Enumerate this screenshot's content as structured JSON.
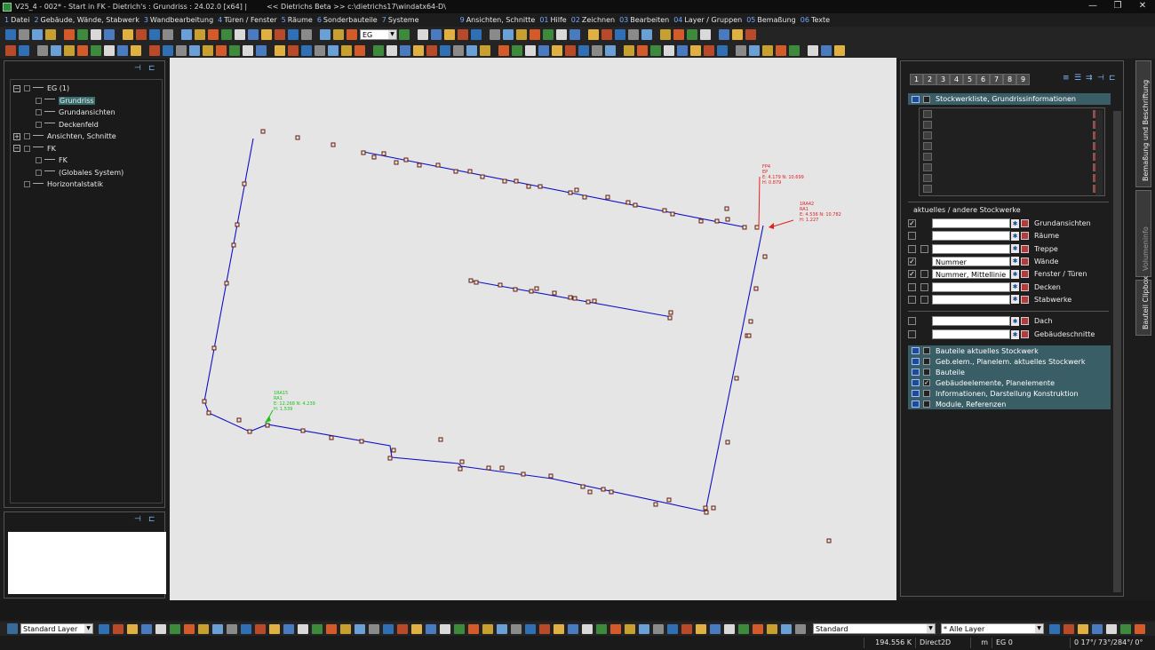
{
  "window": {
    "title_left": "V25_4 - 002* - Start in FK - Dietrich's : Grundriss : 24.02.0 [x64] |",
    "title_right": "<< Dietrichs Beta >> c:\\dietrichs17\\windatx64-D\\",
    "controls": [
      "—",
      "❐",
      "✕"
    ]
  },
  "menu": [
    {
      "num": "1",
      "label": "Datei"
    },
    {
      "num": "2",
      "label": "Gebäude, Wände, Stabwerk"
    },
    {
      "num": "3",
      "label": "Wandbearbeitung"
    },
    {
      "num": "4",
      "label": "Türen / Fenster"
    },
    {
      "num": "5",
      "label": "Räume"
    },
    {
      "num": "6",
      "label": "Sonderbauteile"
    },
    {
      "num": "7",
      "label": "Systeme"
    },
    {
      "num": "9",
      "label": "Ansichten, Schnitte"
    },
    {
      "num": "01",
      "label": "Hilfe"
    },
    {
      "num": "02",
      "label": "Zeichnen"
    },
    {
      "num": "03",
      "label": "Bearbeiten"
    },
    {
      "num": "04",
      "label": "Layer / Gruppen"
    },
    {
      "num": "05",
      "label": "Bemaßung"
    },
    {
      "num": "06",
      "label": "Texte"
    }
  ],
  "toolbar": {
    "floor_select": "EG"
  },
  "tree": [
    {
      "level": 0,
      "expander": "−",
      "label": "EG (1)",
      "selected": false
    },
    {
      "level": 1,
      "expander": "",
      "label": "Grundriss",
      "selected": true
    },
    {
      "level": 1,
      "expander": "",
      "label": "Grundansichten",
      "selected": false
    },
    {
      "level": 1,
      "expander": "",
      "label": "Deckenfeld",
      "selected": false
    },
    {
      "level": 0,
      "expander": "+",
      "label": "Ansichten, Schnitte",
      "selected": false
    },
    {
      "level": 0,
      "expander": "−",
      "label": "FK",
      "selected": false
    },
    {
      "level": 1,
      "expander": "",
      "label": "FK",
      "selected": false
    },
    {
      "level": 1,
      "expander": "",
      "label": "(Globales System)",
      "selected": false
    },
    {
      "level": 0,
      "expander": "",
      "label": "Horizontalstatik",
      "selected": false
    }
  ],
  "right_panel": {
    "tabs": [
      "1",
      "2",
      "3",
      "4",
      "5",
      "6",
      "7",
      "8",
      "9"
    ],
    "header": "Stockwerkliste, Grundrissinformationen",
    "group_label": "aktuelles / andere Stockwerke",
    "layers": [
      {
        "label": "Grundansichten",
        "checked": true,
        "value": "",
        "dual": false
      },
      {
        "label": "Räume",
        "checked": false,
        "value": "",
        "dual": false
      },
      {
        "label": "Treppe",
        "checked": false,
        "value": "",
        "dual": true
      },
      {
        "label": "Wände",
        "checked": true,
        "value": "Nummer",
        "dual": false
      },
      {
        "label": "Fenster / Türen",
        "checked": true,
        "value": "Nummer, Mittellinie",
        "dual": true
      },
      {
        "label": "Decken",
        "checked": false,
        "value": "",
        "dual": true
      },
      {
        "label": "Stabwerke",
        "checked": false,
        "value": "",
        "dual": true
      }
    ],
    "layers2": [
      {
        "label": "Dach",
        "checked": false,
        "value": ""
      },
      {
        "label": "Gebäudeschnitte",
        "checked": false,
        "value": ""
      }
    ],
    "info_rows": [
      {
        "label": "Bauteile aktuelles Stockwerk",
        "checked": false
      },
      {
        "label": "Geb.elem., Planelem. aktuelles Stockwerk",
        "checked": false
      },
      {
        "label": "Bauteile",
        "checked": false
      },
      {
        "label": "Gebäudeelemente, Planelemente",
        "checked": true
      },
      {
        "label": "Informationen, Darstellung Konstruktion",
        "checked": false
      },
      {
        "label": "Module, Referenzen",
        "checked": false
      }
    ]
  },
  "side_tabs": [
    "Bemaßung und Beschriftung",
    "Volumeninfo",
    "Bauteil Clipbox"
  ],
  "annotations": {
    "fp4": [
      "FP4",
      "EP",
      "E: 4.179 N: 10.699",
      "H: 0.879"
    ],
    "ra42": [
      "1RA42",
      "RA1",
      "E: 4.536 N: 10.782",
      "H: 1.227"
    ],
    "ra15": [
      "1RA15",
      "RA1",
      "E: 12.268 N: 4.239",
      "H: 1.539"
    ]
  },
  "colors": {
    "wall_line": "#1010c8",
    "annotation_red": "#e02020",
    "annotation_green": "#20c020",
    "canvas": "#e5e5e5",
    "panel_accent": "#3a5e66"
  },
  "bottom_toolbar": {
    "layer_select": "Standard Layer",
    "style_select": "Standard",
    "layers_filter": "* Alle Layer"
  },
  "status": {
    "memory": "194.556 K",
    "renderer": "Direct2D",
    "unit": "m",
    "floor": "EG 0",
    "angles": "0 17°/ 73°/284°/ 0°"
  }
}
